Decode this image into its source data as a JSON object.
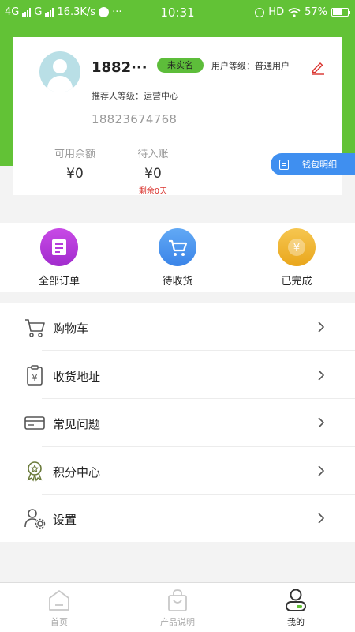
{
  "status_bar": {
    "network1": "4G",
    "network2": "G",
    "speed": "16.3K/s",
    "dots": "···",
    "time": "10:31",
    "hd": "HD",
    "battery": "57%"
  },
  "profile": {
    "nickname": "1882···",
    "auth_status": "未实名",
    "user_level": "用户等级：普通用户",
    "referrer_level": "推荐人等级：运营中心",
    "phone": "18823674768",
    "balance_label": "可用余额",
    "balance_value": "¥0",
    "pending_label": "待入账",
    "pending_value": "¥0",
    "remaining": "剩余0天"
  },
  "wallet_button": {
    "label": "钱包明细"
  },
  "orders": [
    {
      "label": "全部订单",
      "icon": "all-orders-icon",
      "color": "#b53ddc"
    },
    {
      "label": "待收货",
      "icon": "cart-icon",
      "color": "#4a95ef"
    },
    {
      "label": "已完成",
      "icon": "yen-coin-icon",
      "color": "#f0b52e"
    }
  ],
  "menu": [
    {
      "label": "购物车",
      "icon": "shopping-cart-icon"
    },
    {
      "label": "收货地址",
      "icon": "address-clipboard-icon"
    },
    {
      "label": "常见问题",
      "icon": "card-icon"
    },
    {
      "label": "积分中心",
      "icon": "medal-icon"
    },
    {
      "label": "设置",
      "icon": "user-settings-icon"
    }
  ],
  "bottom_nav": [
    {
      "label": "首页",
      "icon": "home-icon"
    },
    {
      "label": "产品说明",
      "icon": "shopping-bag-icon"
    },
    {
      "label": "我的",
      "icon": "profile-icon"
    }
  ],
  "colors": {
    "brand_green": "#62c236",
    "wallet_blue": "#3f8ff0",
    "warning_red": "#d9302b"
  }
}
